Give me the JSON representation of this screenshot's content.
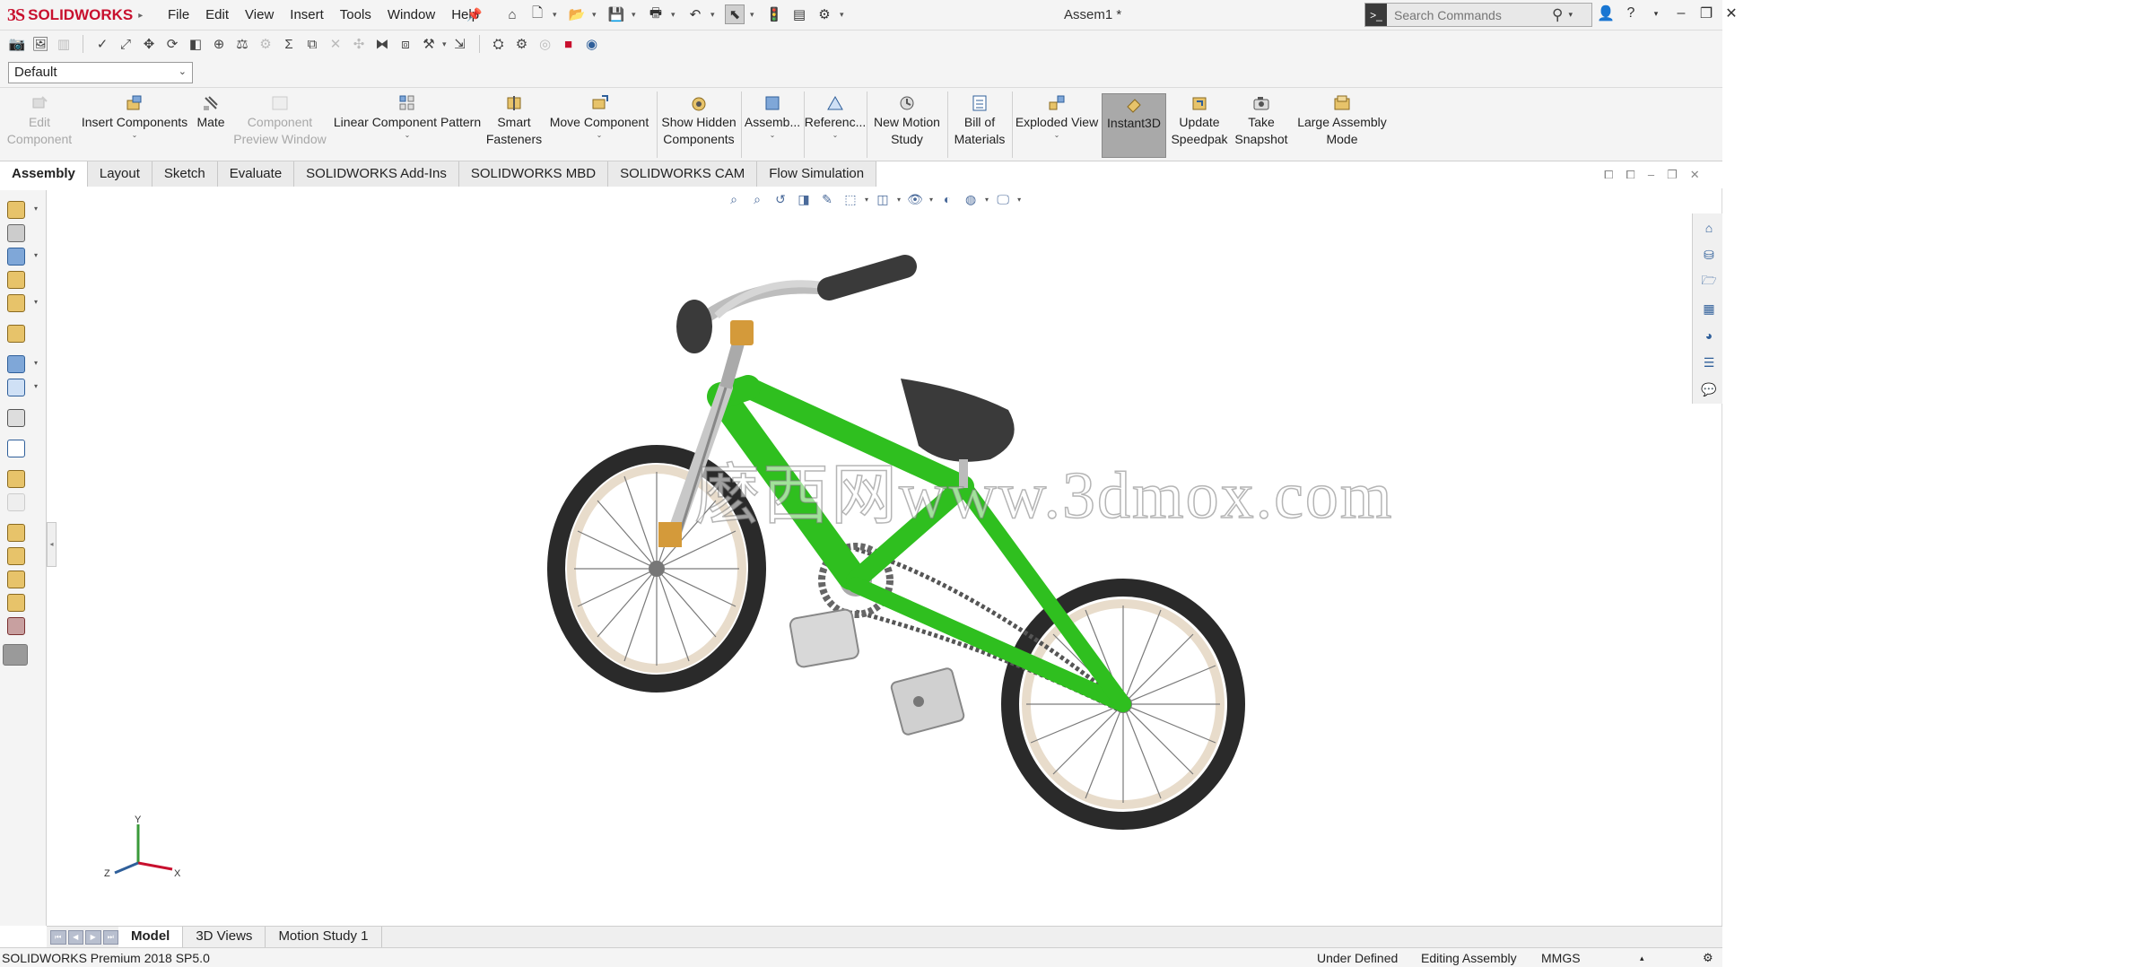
{
  "app": {
    "brand_ds": "3S",
    "brand_name": "SOLIDWORKS",
    "document_title": "Assem1 *"
  },
  "menu": [
    "File",
    "Edit",
    "View",
    "Insert",
    "Tools",
    "Window",
    "Help"
  ],
  "search": {
    "placeholder": "Search Commands"
  },
  "window_controls": [
    "person-icon",
    "help-icon",
    "minimize-icon",
    "restore-icon",
    "close-icon"
  ],
  "configuration": {
    "selected": "Default"
  },
  "ribbon": {
    "edit_component": {
      "line1": "Edit",
      "line2": "Component"
    },
    "insert_components": "Insert Components",
    "mate": "Mate",
    "component_preview": {
      "line1": "Component",
      "line2": "Preview Window"
    },
    "linear_pattern": "Linear Component Pattern",
    "smart_fasteners": {
      "line1": "Smart",
      "line2": "Fasteners"
    },
    "move_component": "Move Component",
    "show_hidden": {
      "line1": "Show Hidden",
      "line2": "Components"
    },
    "assembly_features": "Assemb...",
    "reference_geometry": "Referenc...",
    "new_motion_study": {
      "line1": "New Motion",
      "line2": "Study"
    },
    "bill_of_materials": {
      "line1": "Bill of",
      "line2": "Materials"
    },
    "exploded_view": "Exploded View",
    "instant3d": "Instant3D",
    "update_speedpak": {
      "line1": "Update",
      "line2": "Speedpak"
    },
    "take_snapshot": {
      "line1": "Take",
      "line2": "Snapshot"
    },
    "large_assembly": {
      "line1": "Large Assembly",
      "line2": "Mode"
    }
  },
  "command_tabs": [
    "Assembly",
    "Layout",
    "Sketch",
    "Evaluate",
    "SOLIDWORKS Add-Ins",
    "SOLIDWORKS MBD",
    "SOLIDWORKS CAM",
    "Flow Simulation"
  ],
  "active_command_tab": "Assembly",
  "graphics": {
    "watermark": "麽西网www.3dmox.com",
    "triad": {
      "x": "X",
      "y": "Y",
      "z": "Z"
    },
    "model_colors": {
      "frame": "#2fbf1f",
      "tire": "#2a2a2a",
      "rim": "#e8dccb",
      "saddle": "#3a3a3a",
      "stem": "#d49a3a"
    }
  },
  "bottom_tabs": [
    "Model",
    "3D Views",
    "Motion Study 1"
  ],
  "active_bottom_tab": "Model",
  "status": {
    "version": "SOLIDWORKS Premium 2018 SP5.0",
    "definition": "Under Defined",
    "mode": "Editing Assembly",
    "units": "MMGS"
  }
}
